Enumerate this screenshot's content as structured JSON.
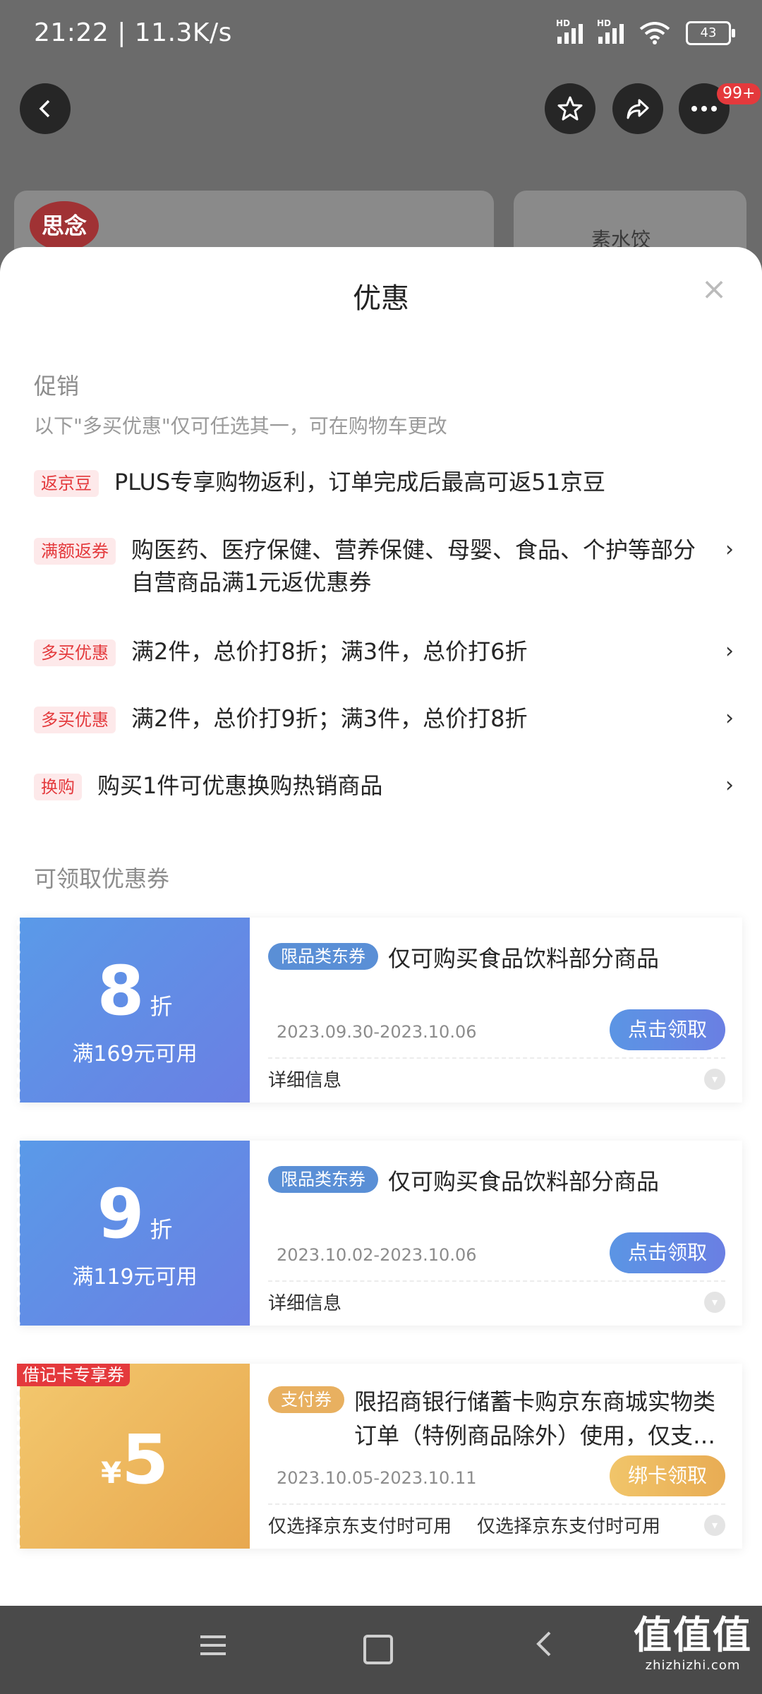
{
  "status_bar": {
    "time": "21:22 | 11.3K/s",
    "hd_label": "HD",
    "battery": "43"
  },
  "header": {
    "more_badge": "99+",
    "bg_logo_text": "思念",
    "bg_product_text": "素水饺"
  },
  "sheet": {
    "title": "优惠",
    "close_glyph": "×",
    "promotions": {
      "title": "促销",
      "note": "以下\"多买优惠\"仅可任选其一，可在购物车更改",
      "items": [
        {
          "tag": "返京豆",
          "text": "PLUS专享购物返利，订单完成后最高可返51京豆",
          "chevron": ""
        },
        {
          "tag": "满额返券",
          "text": "购医药、医疗保健、营养保健、母婴、食品、个护等部分自营商品满1元返优惠券",
          "chevron": "›"
        },
        {
          "tag": "多买优惠",
          "text": "满2件，总价打8折；满3件，总价打6折",
          "chevron": "›"
        },
        {
          "tag": "多买优惠",
          "text": "满2件，总价打9折；满3件，总价打8折",
          "chevron": "›"
        },
        {
          "tag": "换购",
          "text": "购买1件可优惠换购热销商品",
          "chevron": "›"
        }
      ]
    },
    "coupons_section": {
      "title": "可领取优惠券",
      "coupons": [
        {
          "value": "8",
          "unit": "折",
          "condition": "满169元可用",
          "type_tag": "限品类东券",
          "description": "仅可购买食品饮料部分商品",
          "date": "2023.09.30-2023.10.06",
          "button": "点击领取",
          "footer": "详细信息"
        },
        {
          "value": "9",
          "unit": "折",
          "condition": "满119元可用",
          "type_tag": "限品类东券",
          "description": "仅可购买食品饮料部分商品",
          "date": "2023.10.02-2023.10.06",
          "button": "点击领取",
          "footer": "详细信息"
        },
        {
          "corner_tag": "借记卡专享券",
          "currency": "¥",
          "value": "5",
          "type_tag": "支付券",
          "description": "限招商银行储蓄卡购京东商城实物类订单（特例商品除外）使用，仅支持有…",
          "date": "2023.10.05-2023.10.11",
          "button": "绑卡领取",
          "footer_1": "仅选择京东支付时可用",
          "footer_2": "仅选择京东支付时可用"
        }
      ]
    }
  },
  "watermark": {
    "logo": "值值值",
    "site": "zhizhizhi.com"
  },
  "colors": {
    "accent_red": "#e4393c",
    "coupon_blue": "#5a9ae8",
    "coupon_gold": "#f3c86e"
  }
}
